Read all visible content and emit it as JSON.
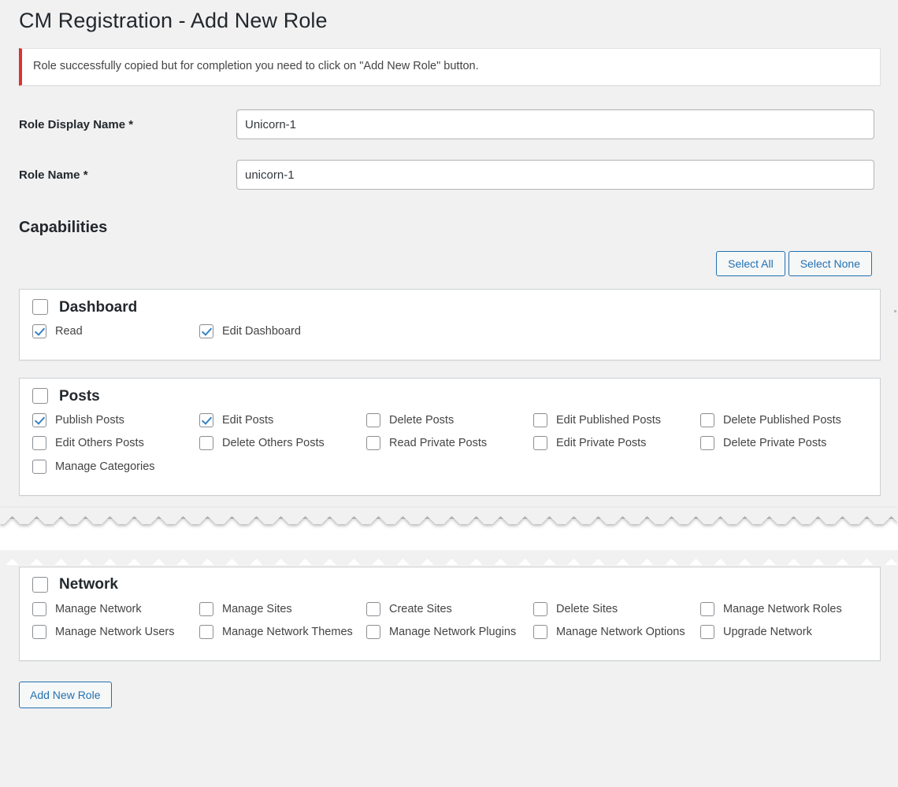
{
  "page": {
    "title": "CM Registration - Add New Role"
  },
  "notice": {
    "message": "Role successfully copied but for completion you need to click on \"Add New Role\" button.",
    "accent_color": "#dc3232",
    "icon": "notice-error-bar"
  },
  "form": {
    "fields": [
      {
        "label": "Role Display Name *",
        "value": "Unicorn-1",
        "placeholder": "",
        "name": "role-display-name"
      },
      {
        "label": "Role Name *",
        "value": "unicorn-1",
        "placeholder": "",
        "name": "role-name"
      }
    ]
  },
  "capabilities": {
    "heading": "Capabilities",
    "select_all_label": "Select All",
    "select_none_label": "Select None",
    "accent_color": "#2271b1",
    "groups": [
      {
        "name": "dashboard",
        "title": "Dashboard",
        "checked": false,
        "items": [
          {
            "label": "Read",
            "checked": true
          },
          {
            "label": "Edit Dashboard",
            "checked": true
          }
        ]
      },
      {
        "name": "posts",
        "title": "Posts",
        "checked": false,
        "items": [
          {
            "label": "Publish Posts",
            "checked": true
          },
          {
            "label": "Edit Posts",
            "checked": true
          },
          {
            "label": "Delete Posts",
            "checked": false
          },
          {
            "label": "Edit Published Posts",
            "checked": false
          },
          {
            "label": "Delete Published Posts",
            "checked": false
          },
          {
            "label": "Edit Others Posts",
            "checked": false
          },
          {
            "label": "Delete Others Posts",
            "checked": false
          },
          {
            "label": "Read Private Posts",
            "checked": false
          },
          {
            "label": "Edit Private Posts",
            "checked": false
          },
          {
            "label": "Delete Private Posts",
            "checked": false
          },
          {
            "label": "Manage Categories",
            "checked": false
          }
        ]
      },
      {
        "name": "network",
        "title": "Network",
        "checked": false,
        "items": [
          {
            "label": "Manage Network",
            "checked": false
          },
          {
            "label": "Manage Sites",
            "checked": false
          },
          {
            "label": "Create Sites",
            "checked": false
          },
          {
            "label": "Delete Sites",
            "checked": false
          },
          {
            "label": "Manage Network Roles",
            "checked": false
          },
          {
            "label": "Manage Network Users",
            "checked": false
          },
          {
            "label": "Manage Network Themes",
            "checked": false
          },
          {
            "label": "Manage Network Plugins",
            "checked": false
          },
          {
            "label": "Manage Network Options",
            "checked": false
          },
          {
            "label": "Upgrade Network",
            "checked": false
          }
        ]
      }
    ]
  },
  "submit": {
    "label": "Add New Role"
  }
}
